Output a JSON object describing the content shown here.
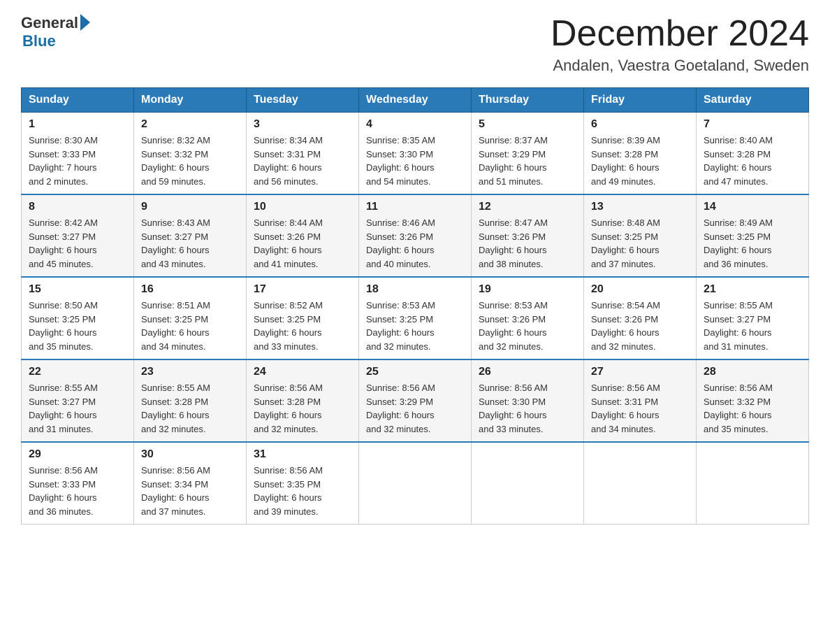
{
  "logo": {
    "general": "General",
    "blue": "Blue"
  },
  "header": {
    "title": "December 2024",
    "subtitle": "Andalen, Vaestra Goetaland, Sweden"
  },
  "weekdays": [
    "Sunday",
    "Monday",
    "Tuesday",
    "Wednesday",
    "Thursday",
    "Friday",
    "Saturday"
  ],
  "weeks": [
    [
      {
        "day": "1",
        "sunrise": "8:30 AM",
        "sunset": "3:33 PM",
        "daylight": "7 hours and 2 minutes."
      },
      {
        "day": "2",
        "sunrise": "8:32 AM",
        "sunset": "3:32 PM",
        "daylight": "6 hours and 59 minutes."
      },
      {
        "day": "3",
        "sunrise": "8:34 AM",
        "sunset": "3:31 PM",
        "daylight": "6 hours and 56 minutes."
      },
      {
        "day": "4",
        "sunrise": "8:35 AM",
        "sunset": "3:30 PM",
        "daylight": "6 hours and 54 minutes."
      },
      {
        "day": "5",
        "sunrise": "8:37 AM",
        "sunset": "3:29 PM",
        "daylight": "6 hours and 51 minutes."
      },
      {
        "day": "6",
        "sunrise": "8:39 AM",
        "sunset": "3:28 PM",
        "daylight": "6 hours and 49 minutes."
      },
      {
        "day": "7",
        "sunrise": "8:40 AM",
        "sunset": "3:28 PM",
        "daylight": "6 hours and 47 minutes."
      }
    ],
    [
      {
        "day": "8",
        "sunrise": "8:42 AM",
        "sunset": "3:27 PM",
        "daylight": "6 hours and 45 minutes."
      },
      {
        "day": "9",
        "sunrise": "8:43 AM",
        "sunset": "3:27 PM",
        "daylight": "6 hours and 43 minutes."
      },
      {
        "day": "10",
        "sunrise": "8:44 AM",
        "sunset": "3:26 PM",
        "daylight": "6 hours and 41 minutes."
      },
      {
        "day": "11",
        "sunrise": "8:46 AM",
        "sunset": "3:26 PM",
        "daylight": "6 hours and 40 minutes."
      },
      {
        "day": "12",
        "sunrise": "8:47 AM",
        "sunset": "3:26 PM",
        "daylight": "6 hours and 38 minutes."
      },
      {
        "day": "13",
        "sunrise": "8:48 AM",
        "sunset": "3:25 PM",
        "daylight": "6 hours and 37 minutes."
      },
      {
        "day": "14",
        "sunrise": "8:49 AM",
        "sunset": "3:25 PM",
        "daylight": "6 hours and 36 minutes."
      }
    ],
    [
      {
        "day": "15",
        "sunrise": "8:50 AM",
        "sunset": "3:25 PM",
        "daylight": "6 hours and 35 minutes."
      },
      {
        "day": "16",
        "sunrise": "8:51 AM",
        "sunset": "3:25 PM",
        "daylight": "6 hours and 34 minutes."
      },
      {
        "day": "17",
        "sunrise": "8:52 AM",
        "sunset": "3:25 PM",
        "daylight": "6 hours and 33 minutes."
      },
      {
        "day": "18",
        "sunrise": "8:53 AM",
        "sunset": "3:25 PM",
        "daylight": "6 hours and 32 minutes."
      },
      {
        "day": "19",
        "sunrise": "8:53 AM",
        "sunset": "3:26 PM",
        "daylight": "6 hours and 32 minutes."
      },
      {
        "day": "20",
        "sunrise": "8:54 AM",
        "sunset": "3:26 PM",
        "daylight": "6 hours and 32 minutes."
      },
      {
        "day": "21",
        "sunrise": "8:55 AM",
        "sunset": "3:27 PM",
        "daylight": "6 hours and 31 minutes."
      }
    ],
    [
      {
        "day": "22",
        "sunrise": "8:55 AM",
        "sunset": "3:27 PM",
        "daylight": "6 hours and 31 minutes."
      },
      {
        "day": "23",
        "sunrise": "8:55 AM",
        "sunset": "3:28 PM",
        "daylight": "6 hours and 32 minutes."
      },
      {
        "day": "24",
        "sunrise": "8:56 AM",
        "sunset": "3:28 PM",
        "daylight": "6 hours and 32 minutes."
      },
      {
        "day": "25",
        "sunrise": "8:56 AM",
        "sunset": "3:29 PM",
        "daylight": "6 hours and 32 minutes."
      },
      {
        "day": "26",
        "sunrise": "8:56 AM",
        "sunset": "3:30 PM",
        "daylight": "6 hours and 33 minutes."
      },
      {
        "day": "27",
        "sunrise": "8:56 AM",
        "sunset": "3:31 PM",
        "daylight": "6 hours and 34 minutes."
      },
      {
        "day": "28",
        "sunrise": "8:56 AM",
        "sunset": "3:32 PM",
        "daylight": "6 hours and 35 minutes."
      }
    ],
    [
      {
        "day": "29",
        "sunrise": "8:56 AM",
        "sunset": "3:33 PM",
        "daylight": "6 hours and 36 minutes."
      },
      {
        "day": "30",
        "sunrise": "8:56 AM",
        "sunset": "3:34 PM",
        "daylight": "6 hours and 37 minutes."
      },
      {
        "day": "31",
        "sunrise": "8:56 AM",
        "sunset": "3:35 PM",
        "daylight": "6 hours and 39 minutes."
      },
      null,
      null,
      null,
      null
    ]
  ],
  "labels": {
    "sunrise": "Sunrise:",
    "sunset": "Sunset:",
    "daylight": "Daylight:"
  }
}
